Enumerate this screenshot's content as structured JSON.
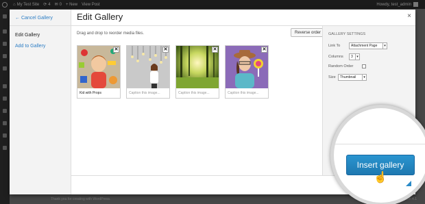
{
  "admin_bar": {
    "site_name": "My Test Site",
    "updates": "4",
    "comments": "0",
    "new_label": "+ New",
    "view_post": "View Post",
    "greeting": "Howdy, test_admin"
  },
  "modal": {
    "title": "Edit Gallery",
    "close_glyph": "×",
    "sidebar": {
      "cancel": "← Cancel Gallery",
      "items": [
        "Edit Gallery",
        "Add to Gallery"
      ]
    },
    "instruction": "Drag and drop to reorder media files.",
    "reverse_button": "Reverse order",
    "thumbnails": [
      {
        "caption": "Kid with Props",
        "caption_filled": true
      },
      {
        "caption": "Caption this image...",
        "caption_filled": false
      },
      {
        "caption": "Caption this image...",
        "caption_filled": false
      },
      {
        "caption": "Caption this image...",
        "caption_filled": false
      }
    ],
    "remove_glyph": "✕",
    "settings": {
      "heading": "GALLERY SETTINGS",
      "link_to_label": "Link To",
      "link_to_value": "Attachment Page",
      "columns_label": "Columns",
      "columns_value": "3",
      "random_order_label": "Random Order",
      "random_order_checked": false,
      "size_label": "Size",
      "size_value": "Thumbnail"
    },
    "insert_button": "Insert gallery"
  },
  "background": {
    "footer_text": "Thank you for creating with WordPress.",
    "version_text": "Version 4.1"
  },
  "colors": {
    "accent": "#2a7cc4",
    "insert_button": "#2a95d0",
    "admin_bar": "#1b1b1b"
  }
}
